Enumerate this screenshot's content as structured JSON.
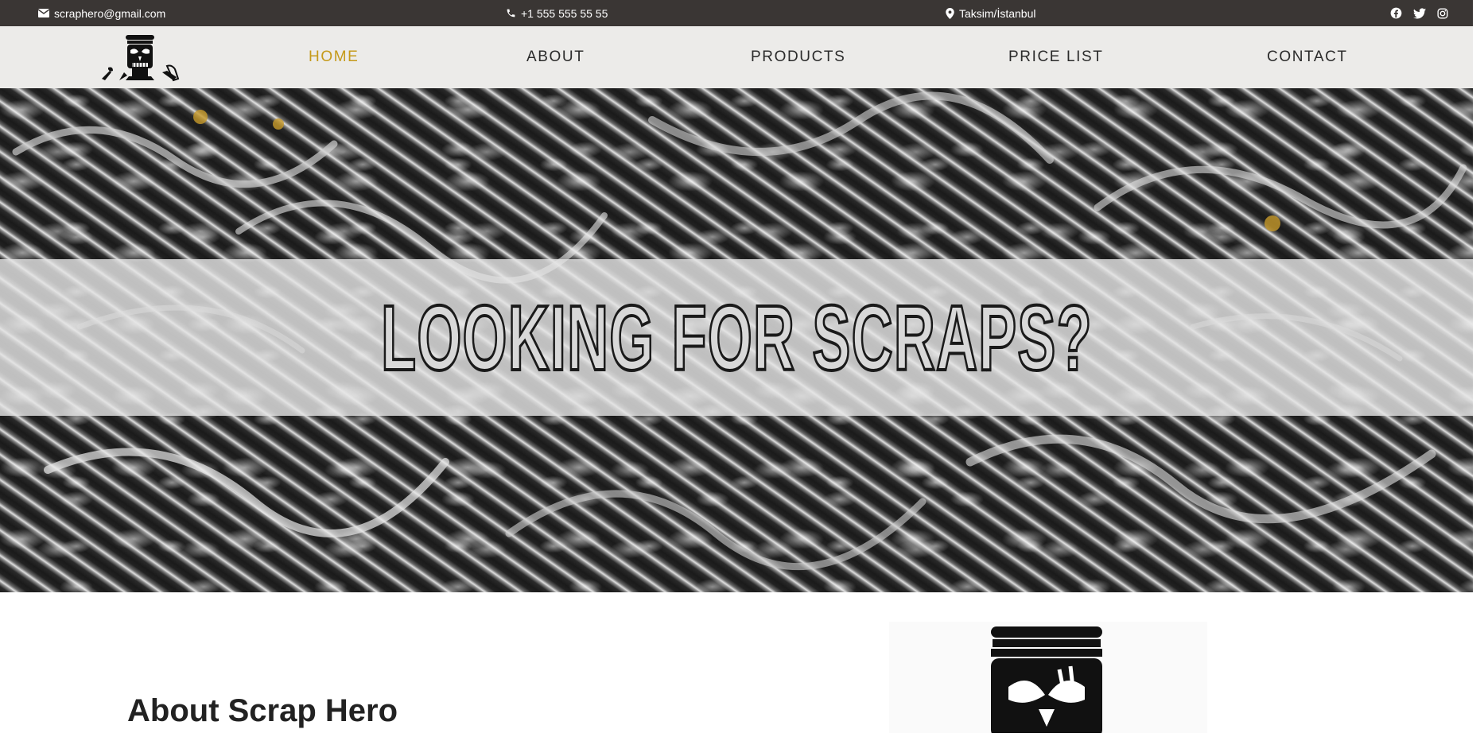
{
  "topbar": {
    "email": "scraphero@gmail.com",
    "phone": "+1 555 555 55 55",
    "location": "Taksim/İstanbul",
    "icons": {
      "email": "envelope-icon",
      "phone": "phone-icon",
      "location": "map-pin-icon",
      "socials": [
        "facebook-icon",
        "twitter-icon",
        "instagram-icon"
      ]
    }
  },
  "nav": {
    "items": [
      {
        "label": "HOME",
        "active": true
      },
      {
        "label": "ABOUT",
        "active": false
      },
      {
        "label": "PRODUCTS",
        "active": false
      },
      {
        "label": "PRICE LIST",
        "active": false
      },
      {
        "label": "CONTACT",
        "active": false
      }
    ],
    "active_color": "#c59a1a"
  },
  "hero": {
    "title": "LOOKING FOR SCRAPS?"
  },
  "about": {
    "title": "About Scrap Hero"
  },
  "colors": {
    "topbar_bg": "#3a3634",
    "navbar_bg": "#ecebe9",
    "accent": "#c59a1a"
  }
}
